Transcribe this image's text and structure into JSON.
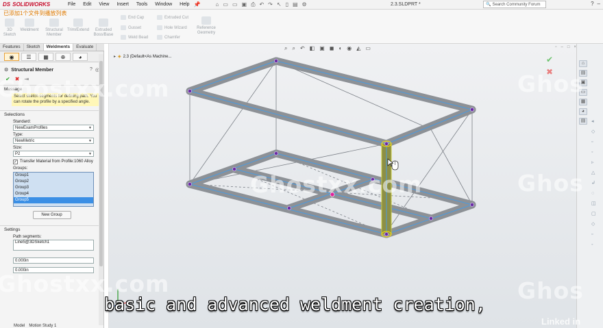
{
  "app": {
    "logo_prefix": "DS",
    "logo_text": "SOLIDWORKS",
    "document_title": "2.3.SLDPRT *",
    "overlay_caption_chinese": "已添加1个文件到播放列表"
  },
  "menu": [
    "File",
    "Edit",
    "View",
    "Insert",
    "Tools",
    "Window",
    "Help"
  ],
  "search": {
    "placeholder": "Search Community Forum"
  },
  "ribbon": {
    "tools": [
      {
        "label": "3D\nSketch"
      },
      {
        "label": "Weldment"
      },
      {
        "label": "Structural\nMember"
      },
      {
        "label": "Trim/Extend"
      },
      {
        "label": "Extruded\nBoss/Base"
      }
    ],
    "small_tools_col1": [
      "End Cap",
      "Gusset",
      "Weld Bead"
    ],
    "small_tools_col2": [
      "Extruded Cut",
      "Hole Wizard",
      "Chamfer"
    ],
    "ref_geometry": "Reference\nGeometry"
  },
  "command_tabs": [
    "Features",
    "Sketch",
    "Weldments",
    "Evaluate"
  ],
  "active_command_tab": "Weldments",
  "property_manager": {
    "title": "Structural Member",
    "message_header": "Message",
    "message": "Select sketch segments for defining path. You can rotate the profile by a specified angle.",
    "selections_header": "Selections",
    "standard_label": "Standard:",
    "standard_value": "NewExamProfiles",
    "type_label": "Type:",
    "type_value": "NewMetric",
    "size_label": "Size:",
    "size_value": "P2",
    "transfer_material": "Transfer Material from Profile:1060 Alloy",
    "groups_label": "Groups:",
    "groups": [
      "Group1",
      "Group2",
      "Group3",
      "Group4",
      "Group5"
    ],
    "selected_group": "Group5",
    "new_group_button": "New Group",
    "settings_header": "Settings",
    "path_segments_label": "Path segments:",
    "path_segments_value": "Line5@3DSketch1",
    "dim1": "0.000in",
    "dim2": "0.000in"
  },
  "bottom_tabs": [
    "Model",
    "Motion Study 1"
  ],
  "feature_tree_item": "2.3  (Default<As Machine...",
  "subtitle": "basic and advanced weldment creation,",
  "watermarks": [
    "Ghostxx.com",
    "Ghostxx.com",
    "Ghostxx.com",
    "Ghos",
    "Ghos",
    "Ghos"
  ],
  "linkedin_label": "Linked in"
}
